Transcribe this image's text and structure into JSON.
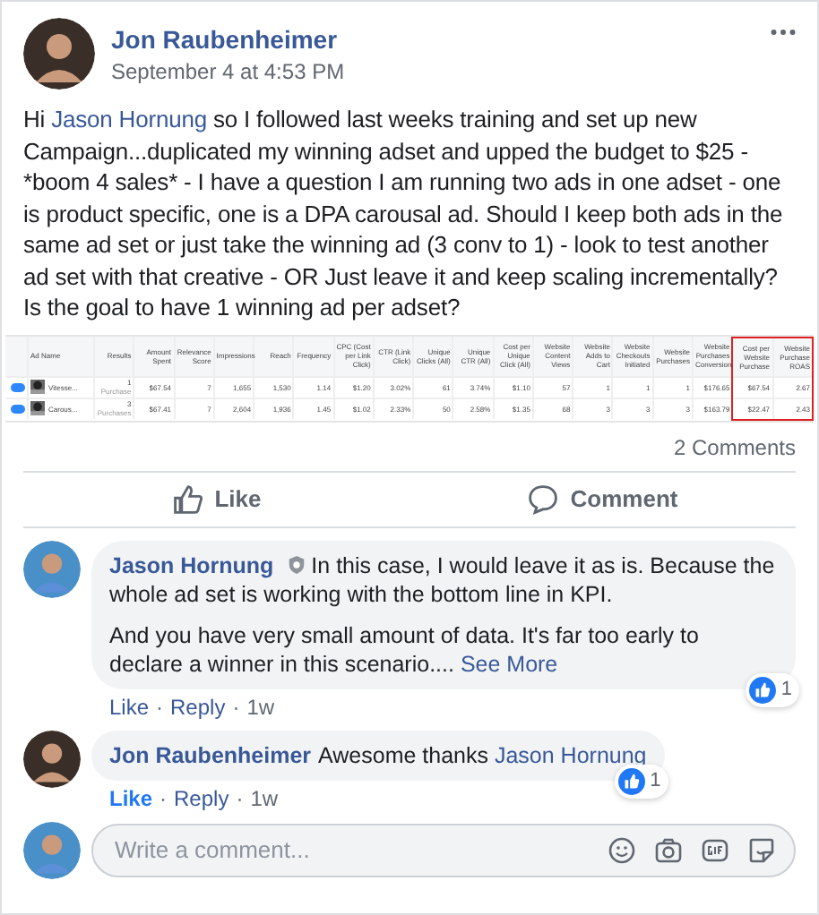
{
  "post": {
    "author": "Jon Raubenheimer",
    "time": "September 4 at 4:53 PM",
    "text": [
      {
        "kind": "text",
        "text": "Hi "
      },
      {
        "kind": "link",
        "text": "Jason Hornung"
      },
      {
        "kind": "text",
        "text": " so I followed last weeks training and set up new Campaign...duplicated my winning adset and upped the budget to $25 - *boom 4 sales* - I have a question I am running two ads in one adset - one is product specific, one is a DPA carousal ad. Should I keep both ads in the same ad set or just take the winning ad (3 conv to 1) - look to test another ad set with that creative - OR Just leave it and keep scaling incrementally? Is the goal to have 1 winning ad per adset?"
      }
    ]
  },
  "ads_table": {
    "columns": [
      {
        "label": "Ad Name",
        "highlighted": false
      },
      {
        "label": "Results",
        "highlighted": false
      },
      {
        "label": "Amount Spent",
        "highlighted": false
      },
      {
        "label": "Relevance Score",
        "highlighted": false
      },
      {
        "label": "Impressions",
        "highlighted": false
      },
      {
        "label": "Reach",
        "highlighted": false
      },
      {
        "label": "Frequency",
        "highlighted": false
      },
      {
        "label": "CPC (Cost per Link Click)",
        "highlighted": false
      },
      {
        "label": "CTR (Link Click)",
        "highlighted": false
      },
      {
        "label": "Unique Clicks (All)",
        "highlighted": false
      },
      {
        "label": "Unique CTR (All)",
        "highlighted": false
      },
      {
        "label": "Cost per Unique Click (All)",
        "highlighted": false
      },
      {
        "label": "Website Content Views",
        "highlighted": false
      },
      {
        "label": "Website Adds to Cart",
        "highlighted": false
      },
      {
        "label": "Website Checkouts Initiated",
        "highlighted": false
      },
      {
        "label": "Website Purchases",
        "highlighted": false
      },
      {
        "label": "Website Purchases Conversion",
        "highlighted": false
      },
      {
        "label": "Cost per Website Purchase",
        "highlighted": true
      },
      {
        "label": "Website Purchase ROAS",
        "highlighted": true
      }
    ],
    "rows": [
      {
        "on": true,
        "cells": [
          {
            "value": "Vitesse..."
          },
          {
            "value": "1",
            "note": "Purchase"
          },
          {
            "value": "$67.54"
          },
          {
            "value": "7"
          },
          {
            "value": "1,655"
          },
          {
            "value": "1,530"
          },
          {
            "value": "1.14"
          },
          {
            "value": "$1.20"
          },
          {
            "value": "3.02%"
          },
          {
            "value": "61"
          },
          {
            "value": "3.74%"
          },
          {
            "value": "$1.10"
          },
          {
            "value": "57"
          },
          {
            "value": "1"
          },
          {
            "value": "1"
          },
          {
            "value": "1"
          },
          {
            "value": "$176.65"
          },
          {
            "value": "$67.54"
          },
          {
            "value": "2.67"
          }
        ]
      },
      {
        "on": true,
        "cells": [
          {
            "value": "Carous..."
          },
          {
            "value": "3",
            "note": "Purchases"
          },
          {
            "value": "$67.41"
          },
          {
            "value": "7"
          },
          {
            "value": "2,604"
          },
          {
            "value": "1,936"
          },
          {
            "value": "1.45"
          },
          {
            "value": "$1.02"
          },
          {
            "value": "2.33%"
          },
          {
            "value": "50"
          },
          {
            "value": "2.58%"
          },
          {
            "value": "$1.35"
          },
          {
            "value": "68"
          },
          {
            "value": "3"
          },
          {
            "value": "3"
          },
          {
            "value": "3"
          },
          {
            "value": "$163.79"
          },
          {
            "value": "$22.47"
          },
          {
            "value": "2.43"
          }
        ]
      }
    ]
  },
  "comment_count": "2 Comments",
  "actions": [
    {
      "kind": "like",
      "label": "Like"
    },
    {
      "kind": "comment",
      "label": "Comment"
    }
  ],
  "comments": [
    {
      "author": "Jason Hornung",
      "badge": true,
      "paragraphs": [
        [
          {
            "kind": "text",
            "text": "In this case, I would leave it as is. Because the whole ad set is working with the bottom line in KPI."
          }
        ],
        [
          {
            "kind": "text",
            "text": "And you have very small amount of data. It's far too early to declare a winner in this scenario.... "
          },
          {
            "kind": "link",
            "text": "See More"
          }
        ]
      ],
      "likes": "1",
      "like": "Like",
      "sep": "·",
      "reply": "Reply",
      "age": "1w",
      "liked": false
    },
    {
      "author": "Jon Raubenheimer",
      "badge": false,
      "paragraphs": [
        [
          {
            "kind": "text",
            "text": "Awesome thanks "
          },
          {
            "kind": "mention",
            "text": "Jason Hornung"
          }
        ]
      ],
      "likes": "1",
      "like": "Like",
      "sep": "·",
      "reply": "Reply",
      "age": "1w",
      "liked": true
    }
  ],
  "composer": {
    "placeholder": "Write a comment..."
  }
}
